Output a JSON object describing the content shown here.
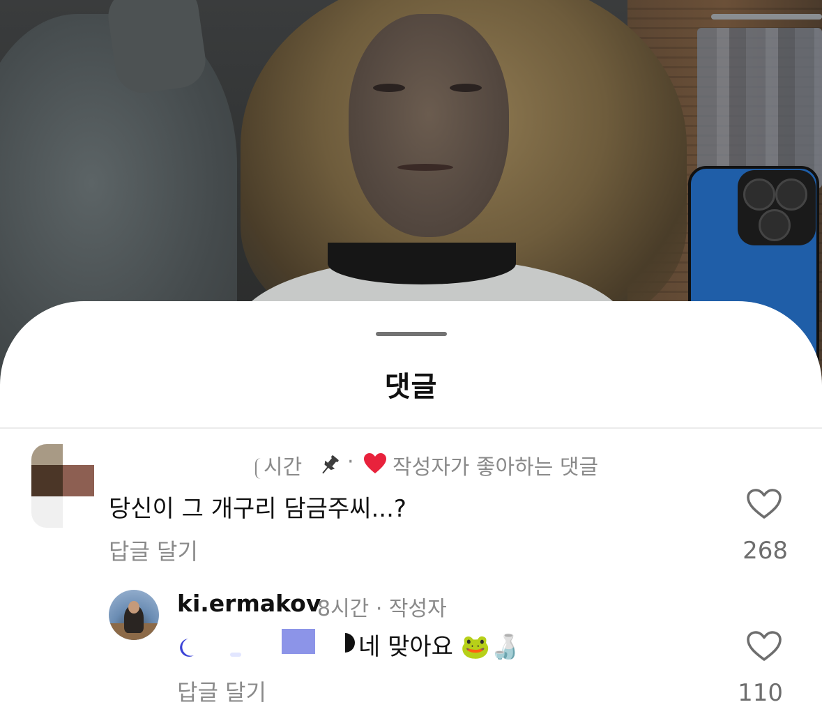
{
  "sheet": {
    "title": "댓글"
  },
  "comments": [
    {
      "meta_time": "시간",
      "meta_dot": "·",
      "meta_creator_liked": "작성자가 좋아하는 댓글",
      "text": "당신이 그 개구리 담금주씨...?",
      "reply_label": "답글 달기",
      "like_count": "268"
    }
  ],
  "reply": {
    "username": "ki.ermakov",
    "meta": "8시간 · 작성자",
    "text": "네 맞아요 🐸🍶",
    "reply_label": "답글 달기",
    "like_count": "110"
  },
  "colors": {
    "heart": "#e8223c",
    "pin": "#3d3d3d",
    "muted_text": "#8a8a8a",
    "censor_block": "#8c94e8"
  }
}
